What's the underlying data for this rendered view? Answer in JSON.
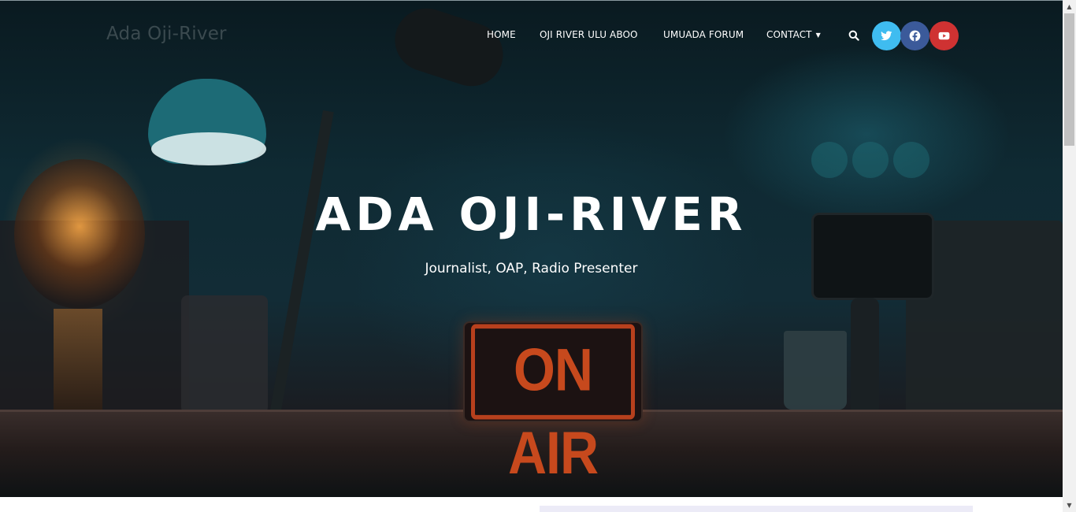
{
  "site": {
    "title": "Ada Oji-River"
  },
  "nav": {
    "items": [
      {
        "label": "HOME"
      },
      {
        "label": "OJI RIVER ULU ABOO"
      },
      {
        "label": "UMUADA FORUM"
      },
      {
        "label": "CONTACT",
        "has_dropdown": true
      }
    ],
    "search_icon": "search-icon"
  },
  "social": [
    {
      "name": "twitter",
      "icon": "twitter-icon",
      "color": "#3fbcf0"
    },
    {
      "name": "facebook",
      "icon": "facebook-icon",
      "color": "#3b5a9a"
    },
    {
      "name": "youtube",
      "icon": "youtube-icon",
      "color": "#cf3232"
    }
  ],
  "hero": {
    "title": "ADA OJI-RIVER",
    "subtitle": "Journalist, OAP, Radio Presenter",
    "sign_text": "ON AIR"
  },
  "colors": {
    "nav_text": "#ffffff",
    "sign_orange": "#c7491d"
  }
}
